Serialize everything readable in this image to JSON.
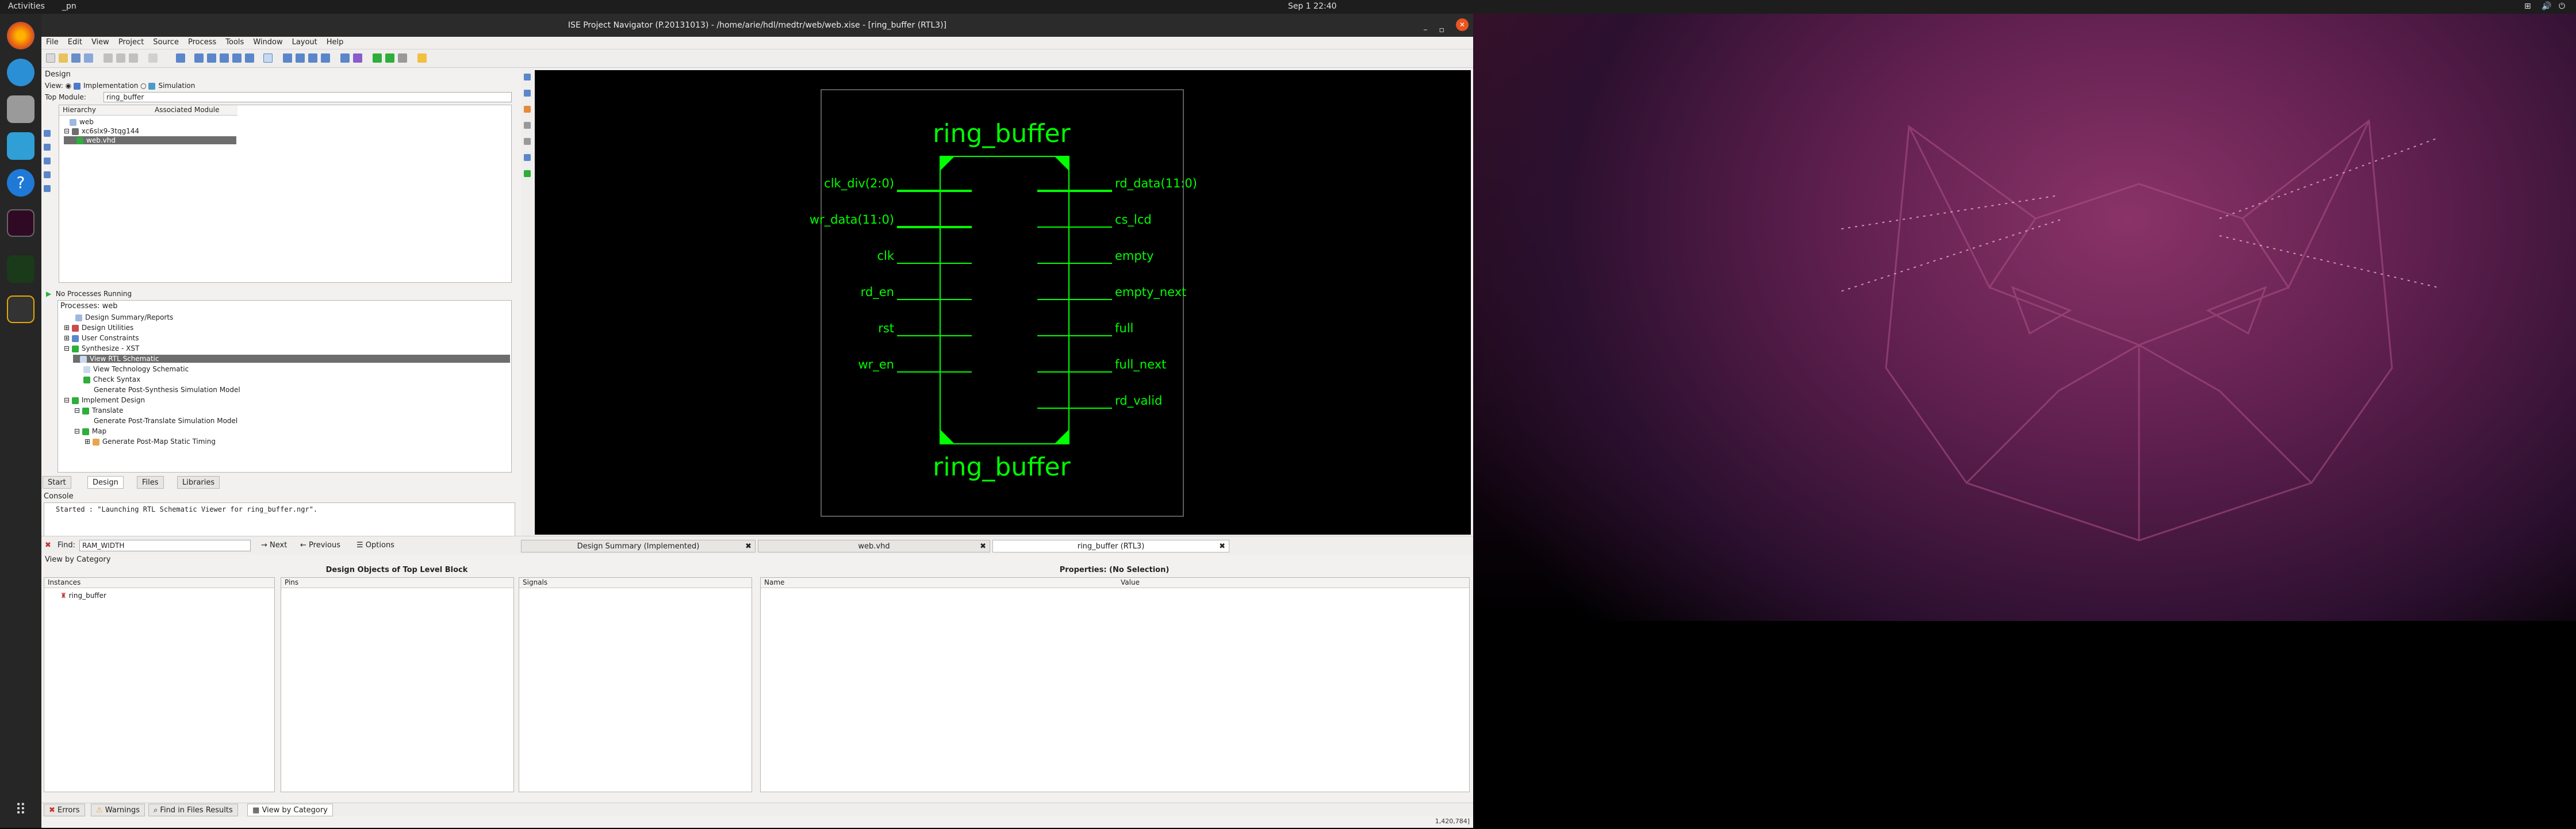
{
  "topbar": {
    "activities": "Activities",
    "app": "_pn",
    "clock": "Sep 1  22:40"
  },
  "window": {
    "title": "ISE Project Navigator (P.20131013) - /home/arie/hdl/medtr/web/web.xise - [ring_buffer (RTL3)]"
  },
  "menu": [
    "File",
    "Edit",
    "View",
    "Project",
    "Source",
    "Process",
    "Tools",
    "Window",
    "Layout",
    "Help"
  ],
  "design": {
    "title": "Design",
    "view_label": "View:",
    "impl": "Implementation",
    "sim": "Simulation",
    "top_label": "Top Module:",
    "top_value": "ring_buffer",
    "col1": "Hierarchy",
    "col2": "Associated Module",
    "tree": [
      "web",
      "xc6slx9-3tqg144",
      "web.vhd"
    ]
  },
  "processes": {
    "status": "No Processes Running",
    "title": "Processes: web",
    "items": [
      "Design Summary/Reports",
      "Design Utilities",
      "User Constraints",
      "Synthesize - XST",
      "View RTL Schematic",
      "View Technology Schematic",
      "Check Syntax",
      "Generate Post-Synthesis Simulation Model",
      "Implement Design",
      "Translate",
      "Generate Post-Translate Simulation Model",
      "Map",
      "Generate Post-Map Static Timing"
    ]
  },
  "left_tabs": [
    "Start",
    "Design",
    "Files",
    "Libraries"
  ],
  "console": {
    "title": "Console",
    "text": "Started : \"Launching RTL Schematic Viewer for ring_buffer.ngr\"."
  },
  "find": {
    "label": "Find:",
    "value": "RAM_WIDTH",
    "next": "Next",
    "previous": "Previous",
    "options": "Options"
  },
  "doc_tabs": [
    "Design Summary (Implemented)",
    "web.vhd",
    "ring_buffer (RTL3)"
  ],
  "schematic": {
    "name": "ring_buffer",
    "inputs": [
      "clk_div(2:0)",
      "wr_data(11:0)",
      "clk",
      "rd_en",
      "rst",
      "wr_en"
    ],
    "outputs": [
      "rd_data(11:0)",
      "cs_lcd",
      "empty",
      "empty_next",
      "full",
      "full_next",
      "rd_valid"
    ],
    "color": "#00ff00"
  },
  "bottom": {
    "view_by": "View by Category",
    "objects_title": "Design Objects of Top Level Block",
    "props_title": "Properties: (No Selection)",
    "instances": "Instances",
    "pins": "Pins",
    "signals": "Signals",
    "name": "Name",
    "value": "Value",
    "instance": "ring_buffer"
  },
  "bottom_tabs": [
    "Errors",
    "Warnings",
    "Find in Files Results",
    "View by Category"
  ],
  "status_coords": "1,420,784]"
}
